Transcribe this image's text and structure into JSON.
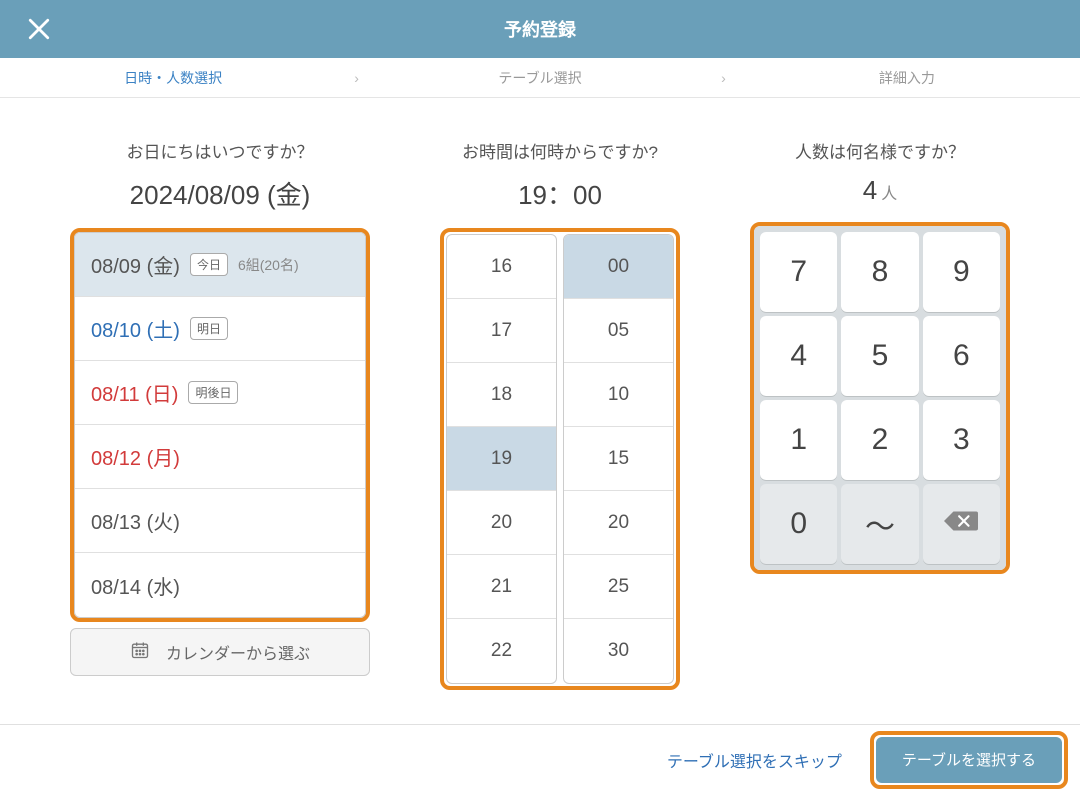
{
  "header": {
    "title": "予約登録"
  },
  "steps": {
    "items": [
      {
        "label": "日時・人数選択",
        "active": true
      },
      {
        "label": "テーブル選択",
        "active": false
      },
      {
        "label": "詳細入力",
        "active": false
      }
    ]
  },
  "date": {
    "prompt": "お日にちはいつですか？",
    "value": "2024/08/09 (金)",
    "items": [
      {
        "label": "08/09 (金)",
        "tag": "今日",
        "sub": "6組(20名)",
        "selected": true,
        "color": "default"
      },
      {
        "label": "08/10 (土)",
        "tag": "明日",
        "sub": "",
        "selected": false,
        "color": "blue"
      },
      {
        "label": "08/11 (日)",
        "tag": "明後日",
        "sub": "",
        "selected": false,
        "color": "red"
      },
      {
        "label": "08/12 (月)",
        "tag": "",
        "sub": "",
        "selected": false,
        "color": "red"
      },
      {
        "label": "08/13 (火)",
        "tag": "",
        "sub": "",
        "selected": false,
        "color": "default"
      },
      {
        "label": "08/14 (水)",
        "tag": "",
        "sub": "",
        "selected": false,
        "color": "default"
      }
    ],
    "calendar_button": "カレンダーから選ぶ"
  },
  "time": {
    "prompt": "お時間は何時からですか?",
    "value": "19：00",
    "hours": [
      "16",
      "17",
      "18",
      "19",
      "20",
      "21",
      "22"
    ],
    "selected_hour": "19",
    "minutes": [
      "00",
      "05",
      "10",
      "15",
      "20",
      "25",
      "30"
    ],
    "selected_minute": "00"
  },
  "count": {
    "prompt": "人数は何名様ですか？",
    "value": "4",
    "unit": "人",
    "keys": [
      "7",
      "8",
      "9",
      "4",
      "5",
      "6",
      "1",
      "2",
      "3",
      "0",
      "〜",
      "bksp"
    ]
  },
  "footer": {
    "skip": "テーブル選択をスキップ",
    "primary": "テーブルを選択する"
  },
  "colors": {
    "accent": "#6a9fb9",
    "highlight": "#e8871e"
  }
}
